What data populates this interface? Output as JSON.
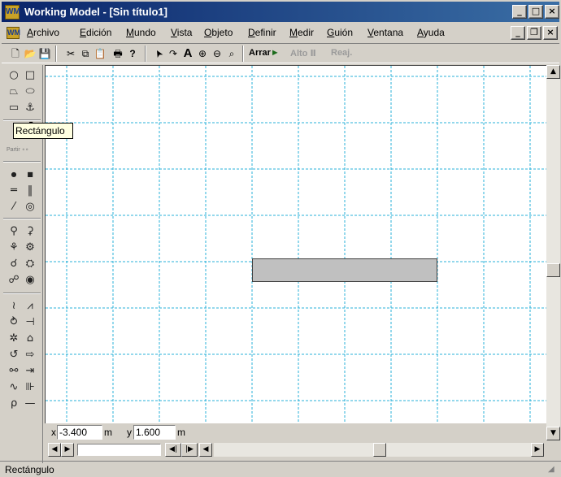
{
  "window": {
    "title": "Working Model - [Sin título1]",
    "app_icon": "WM"
  },
  "menubar": {
    "doc_icon": "WM",
    "items": [
      "Archivo",
      "Edición",
      "Mundo",
      "Vista",
      "Objeto",
      "Definir",
      "Medir",
      "Guión",
      "Ventana",
      "Ayuda"
    ]
  },
  "toolbar": {
    "run_label": "Arrar",
    "stop_label": "Alto",
    "reset_label": "Reaj."
  },
  "palette": {
    "partir_label": "Partir"
  },
  "tooltip": {
    "text": "Rectángulo"
  },
  "coords": {
    "x_label": "x",
    "x_value": "-3.400",
    "x_unit": "m",
    "y_label": "y",
    "y_value": "1.600",
    "y_unit": "m"
  },
  "statusbar": {
    "text": "Rectángulo"
  },
  "icons": {
    "new": "🗋",
    "open": "📂",
    "save": "💾",
    "cut": "✂",
    "copy": "⧉",
    "paste": "📋",
    "print": "🖶",
    "help": "?",
    "arrow": "➤",
    "rotate": "↷",
    "text": "A",
    "zoom_in": "⊕",
    "zoom_out": "⊖",
    "zoom_fit": "⌕"
  },
  "colors": {
    "title_start": "#0a246a",
    "title_end": "#3a6ea5",
    "grid": "#2ab0d8",
    "body_fill": "#c0c0c0"
  }
}
